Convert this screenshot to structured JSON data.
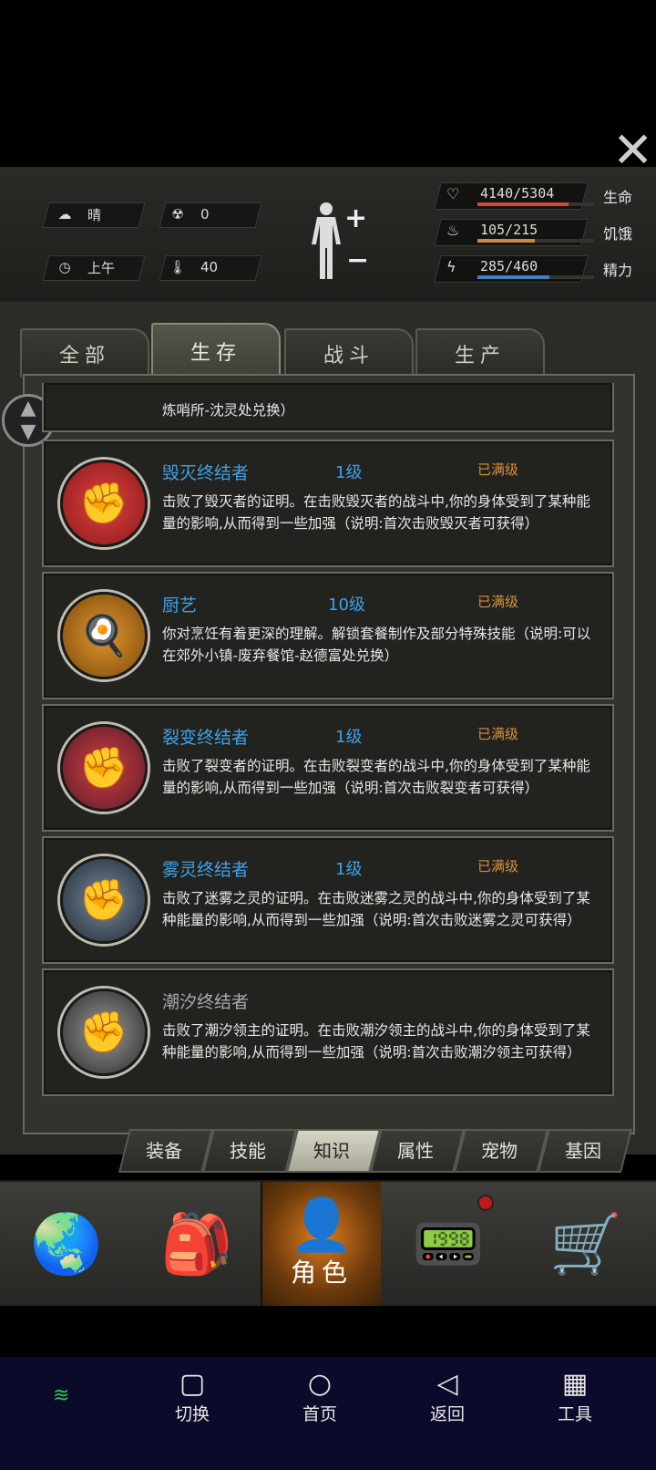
{
  "status": {
    "weather": "晴",
    "radiation": "0",
    "time_of_day": "上午",
    "temperature": "40"
  },
  "vitals": [
    {
      "label": "生命",
      "value": "4140/5304",
      "fraction": 0.78,
      "color": "#d24a3a",
      "icon": "heart-pulse-icon"
    },
    {
      "label": "饥饿",
      "value": "105/215",
      "fraction": 0.49,
      "color": "#c98a3a",
      "icon": "stomach-icon"
    },
    {
      "label": "精力",
      "value": "285/460",
      "fraction": 0.62,
      "color": "#3f82c9",
      "icon": "energy-bolt-icon"
    }
  ],
  "category_tabs": [
    "全部",
    "生存",
    "战斗",
    "生产"
  ],
  "active_category_tab": 1,
  "partial_card_text": "炼哨所-沈灵处兑换）",
  "cards": [
    {
      "title": "毁灭终结者",
      "level": "1级",
      "max": "已满级",
      "desc": "击败了毁灭者的证明。在击败毁灭者的战斗中,你的身体受到了某种能量的影响,从而得到一些加强（说明:首次击败毁灭者可获得）",
      "icon": "fist-icon",
      "emblem_color": "#b82a2a"
    },
    {
      "title": "厨艺",
      "level": "10级",
      "max": "已满级",
      "desc": "你对烹饪有着更深的理解。解锁套餐制作及部分特殊技能（说明:可以在郊外小镇-废弃餐馆-赵德富处兑换）",
      "icon": "chef-hat-icon",
      "emblem_color": "#c07820"
    },
    {
      "title": "裂变终结者",
      "level": "1级",
      "max": "已满级",
      "desc": "击败了裂变者的证明。在击败裂变者的战斗中,你的身体受到了某种能量的影响,从而得到一些加强（说明:首次击败裂变者可获得）",
      "icon": "fist-icon",
      "emblem_color": "#a83030"
    },
    {
      "title": "雾灵终结者",
      "level": "1级",
      "max": "已满级",
      "desc": "击败了迷雾之灵的证明。在击败迷雾之灵的战斗中,你的身体受到了某种能量的影响,从而得到一些加强（说明:首次击败迷雾之灵可获得）",
      "icon": "fist-icon",
      "emblem_color": "#4a5a6a"
    },
    {
      "title": "潮汐终结者",
      "level": "",
      "max": "",
      "desc": "击败了潮汐领主的证明。在击败潮汐领主的战斗中,你的身体受到了某种能量的影响,从而得到一些加强（说明:首次击败潮汐领主可获得）",
      "icon": "fist-icon",
      "emblem_color": "#3a3a3a"
    }
  ],
  "sub_tabs": [
    "装备",
    "技能",
    "知识",
    "属性",
    "宠物",
    "基因"
  ],
  "active_sub_tab": 2,
  "bottom_nav": [
    {
      "label": "",
      "icon": "globe-icon"
    },
    {
      "label": "",
      "icon": "backpack-icon"
    },
    {
      "label": "角色",
      "icon": "character-head-icon"
    },
    {
      "label": "",
      "icon": "radio-phone-icon"
    },
    {
      "label": "",
      "icon": "shopping-cart-icon"
    }
  ],
  "system_nav": [
    "切换",
    "首页",
    "返回",
    "工具"
  ]
}
